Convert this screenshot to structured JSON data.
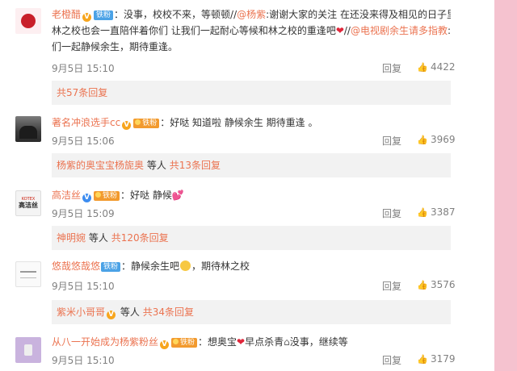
{
  "comments": [
    {
      "user": "老橙醋",
      "fan_badge": "铁粉",
      "text_a": "：没事，校校不来，等顿顿//",
      "mention_1": "@杨紫",
      "text_b": ":谢谢大家的关注  在还没来得及相见的日子里",
      "line2_a": "林之校也会一直陪伴着你们 让我们一起耐心等候和林之校的重逢吧",
      "line2_b": "//",
      "mention_2": "@电视剧余生请多指教",
      "line2_c": ":我",
      "line3": "们一起静候余生，期待重逢。",
      "time": "9月5日 15:10",
      "reply": "回复",
      "likes": "4422",
      "sub_more": "共57条回复"
    },
    {
      "user": "著名冲浪选手cc",
      "fan_badge": "铁粉",
      "text": "：好哒 知道啦 静候余生 期待重逢 。",
      "time": "9月5日 15:06",
      "reply": "回复",
      "likes": "3969",
      "sub_who": "杨紫的奥宝宝杨旎奥",
      "sub_etc": "等人",
      "sub_more": "共13条回复"
    },
    {
      "user": "高洁丝",
      "fan_badge": "铁粉",
      "text": "：好哒 静候",
      "avatar_small": "KOTEX",
      "avatar_big": "高洁丝",
      "time": "9月5日 15:09",
      "reply": "回复",
      "likes": "3387",
      "sub_who": "神明婉",
      "sub_etc": "等人",
      "sub_more": "共120条回复"
    },
    {
      "user": "悠哉悠哉悠",
      "fan_badge": "铁粉",
      "text_a": "：静候余生吧",
      "text_b": "，期待林之校",
      "time": "9月5日 15:10",
      "reply": "回复",
      "likes": "3576",
      "sub_who": "紫米小哥哥",
      "sub_etc": "等人",
      "sub_more": "共34条回复"
    },
    {
      "user": "从八一开始成为杨紫粉丝",
      "fan_badge": "铁粉",
      "text_a": "：想奥宝",
      "text_b": "早点杀青",
      "text_c": "没事，继续等",
      "time": "9月5日 15:10",
      "reply": "回复",
      "likes": "3179"
    }
  ],
  "icons": {
    "verified": "V",
    "like": "thumbs-up-icon",
    "heart": "❤",
    "hearts": "💕",
    "small_heart": "❤",
    "house": "⌂"
  },
  "colors": {
    "username": "#eb7350",
    "meta": "#808080",
    "sub_bg": "#f2f2f2",
    "page_bg": "#f5c2cf"
  }
}
